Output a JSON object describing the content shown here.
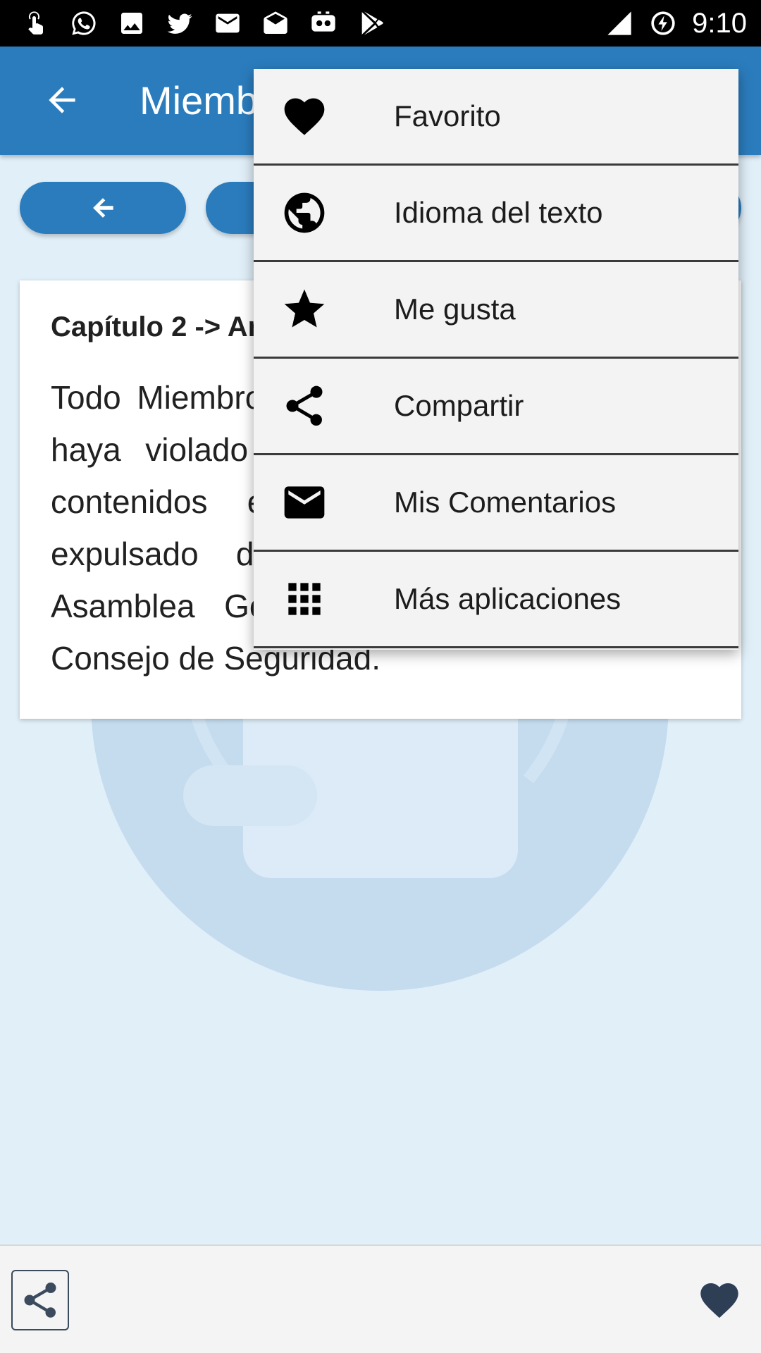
{
  "status_bar": {
    "time": "9:10",
    "notification_icons": [
      "touch-app-icon",
      "whatsapp-icon",
      "image-icon",
      "twitter-icon",
      "mail-icon",
      "mail-open-icon",
      "reddit-icon",
      "play-store-icon"
    ],
    "system_icons": [
      "signal-icon",
      "battery-charging-icon"
    ]
  },
  "app_bar": {
    "title": "Miembros",
    "back_icon": "arrow-left-icon"
  },
  "nav": {
    "prev_icon": "arrow-left-icon"
  },
  "article": {
    "heading": "Capítulo 2 -> Artículo 6",
    "body": "Todo Miembro de las Naciones Unidas que haya violado repetidamente los Principios contenidos en esta Carta podrá ser expulsado de la Organización por la Asamblea General a recomendación del Consejo de Seguridad."
  },
  "menu": {
    "items": [
      {
        "label": "Favorito",
        "icon": "heart-icon"
      },
      {
        "label": "Idioma del texto",
        "icon": "globe-icon"
      },
      {
        "label": "Me gusta",
        "icon": "star-icon"
      },
      {
        "label": "Compartir",
        "icon": "share-icon"
      },
      {
        "label": "Mis Comentarios",
        "icon": "mail-icon"
      },
      {
        "label": "Más aplicaciones",
        "icon": "apps-grid-icon"
      }
    ]
  },
  "bottom_bar": {
    "share_icon": "share-icon",
    "favorite_icon": "heart-icon"
  },
  "colors": {
    "primary": "#2b7cbd",
    "background": "#e1eff9",
    "card": "#ffffff",
    "menu_background": "#f3f3f3",
    "bottom_icon": "#2e3e55"
  }
}
